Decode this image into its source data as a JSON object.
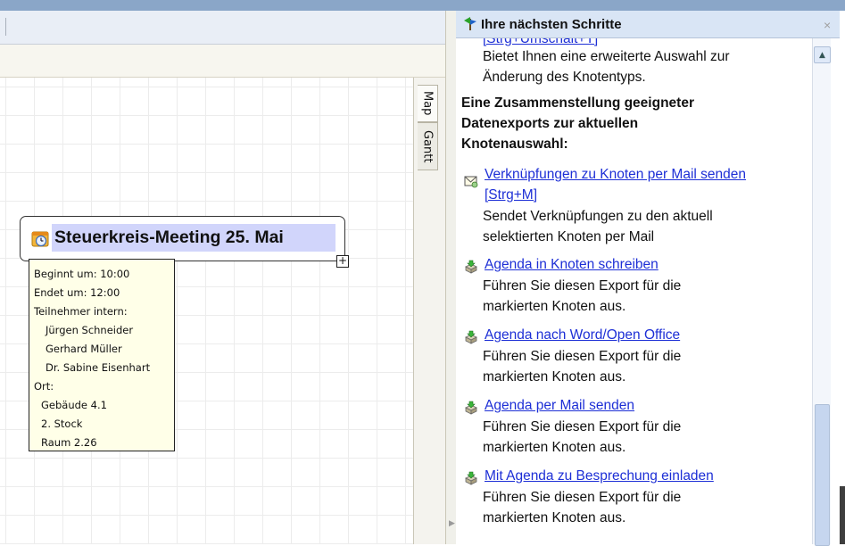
{
  "pane": {
    "title": "Ihre nächsten Schritte",
    "close": "×",
    "cut_top_link": "[Strg+Umschalt+T]",
    "intro_desc": [
      "Bietet Ihnen eine erweiterte Auswahl zur",
      "Änderung des Knotentyps."
    ],
    "section_heading": [
      "Eine Zusammenstellung geeigneter",
      "Datenexports zur aktuellen",
      "Knotenauswahl:"
    ],
    "items": [
      {
        "icon": "mail-link-icon",
        "link": [
          "Verknüpfungen zu Knoten per Mail senden",
          "[Strg+M]"
        ],
        "desc": [
          "Sendet Verknüpfungen zu den aktuell",
          "selektierten Knoten per Mail"
        ]
      },
      {
        "icon": "export-icon",
        "link": [
          "Agenda in Knoten schreiben"
        ],
        "desc": [
          "Führen Sie diesen Export für die",
          "markierten Knoten aus."
        ]
      },
      {
        "icon": "export-icon",
        "link": [
          "Agenda nach Word/Open Office"
        ],
        "desc": [
          "Führen Sie diesen Export für die",
          "markierten Knoten aus."
        ]
      },
      {
        "icon": "export-icon",
        "link": [
          "Agenda per Mail senden"
        ],
        "desc": [
          "Führen Sie diesen Export für die",
          "markierten Knoten aus."
        ]
      },
      {
        "icon": "export-icon",
        "link": [
          "Mit Agenda zu Besprechung einladen"
        ],
        "desc": [
          "Führen Sie diesen Export für die",
          "markierten Knoten aus."
        ]
      }
    ]
  },
  "tabs": {
    "map": "Map",
    "gantt": "Gantt"
  },
  "node": {
    "title": "Steuerkreis-Meeting 25. Mai",
    "icon": "meeting-clock-icon",
    "expand": "+"
  },
  "note": {
    "lines": [
      "Beginnt um: 10:00",
      "Endet um: 12:00",
      "Teilnehmer intern:",
      "Jürgen Schneider",
      "Gerhard Müller",
      "Dr. Sabine Eisenhart",
      "Ort:",
      "Gebäude 4.1",
      "2. Stock",
      "Raum 2.26"
    ]
  },
  "colors": {
    "link": "#1d2fd6",
    "header": "#d9e5f5",
    "selection": "#d1d5fb",
    "note_bg": "#ffffe8"
  }
}
